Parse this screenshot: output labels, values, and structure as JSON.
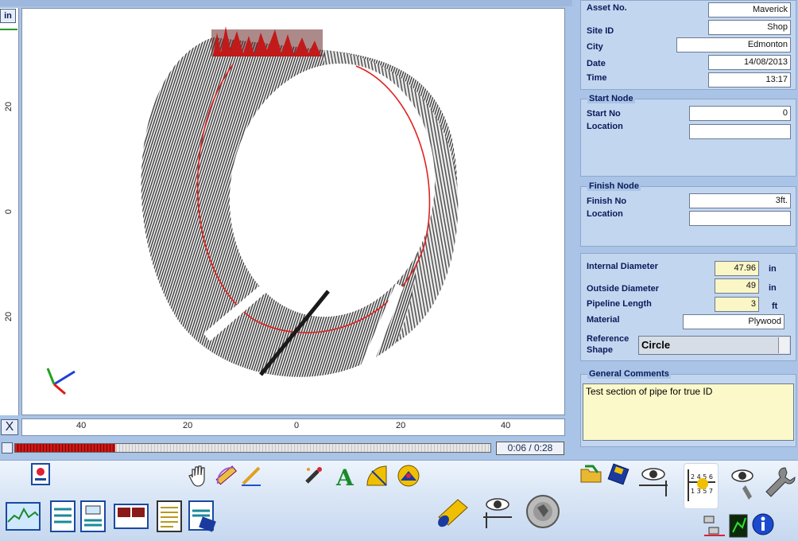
{
  "ruler": {
    "unit": "in",
    "v_ticks": [
      "20",
      "0",
      "20"
    ],
    "h_ticks": [
      "40",
      "20",
      "0",
      "20",
      "40"
    ]
  },
  "close_label": "X",
  "playback": {
    "time": "0:06 / 0:28",
    "progress": 0.21
  },
  "asset": {
    "asset_no_label": "Asset No.",
    "asset_no": "Maverick",
    "site_id_label": "Site ID",
    "site_id": "Shop",
    "city_label": "City",
    "city": "Edmonton",
    "date_label": "Date",
    "date": "14/08/2013",
    "time_label": "Time",
    "time": "13:17"
  },
  "start_node": {
    "title": "Start Node",
    "start_no_label": "Start No",
    "start_no": "0",
    "location_label": "Location",
    "location": ""
  },
  "finish_node": {
    "title": "Finish Node",
    "finish_no_label": "Finish No",
    "finish_no": "3ft.",
    "location_label": "Location",
    "location": ""
  },
  "pipe": {
    "internal_diameter_label": "Internal Diameter",
    "internal_diameter": "47.96",
    "internal_diameter_unit": "in",
    "outside_diameter_label": "Outside Diameter",
    "outside_diameter": "49",
    "outside_diameter_unit": "in",
    "length_label": "Pipeline Length",
    "length": "3",
    "length_unit": "ft",
    "material_label": "Material",
    "material": "Plywood",
    "reference_shape_label_1": "Reference",
    "reference_shape_label_2": "Shape",
    "reference_shape": "Circle"
  },
  "comments": {
    "title": "General Comments",
    "text": "Test section of pipe for true ID"
  },
  "colors": {
    "panel": "#c3d6f0",
    "background": "#a9c4e6",
    "accent_red": "#e02020"
  },
  "icons": [
    "report-icon",
    "hand-pan-icon",
    "ruler-icon",
    "pencil-icon",
    "marker-icon",
    "text-annotate-icon",
    "protractor-icon",
    "gauge-icon",
    "folder-open-icon",
    "save-disk-icon",
    "eye-ruler-icon",
    "profile-grid-icon",
    "eye-settings-icon",
    "wrench-icon",
    "graph-icon",
    "table-icon",
    "report-list-icon",
    "compare-icon",
    "document-icon",
    "export-icon",
    "pipe-3d-icon",
    "eye-measure-icon",
    "cross-section-icon",
    "network-icon",
    "sonar-icon",
    "info-icon"
  ]
}
